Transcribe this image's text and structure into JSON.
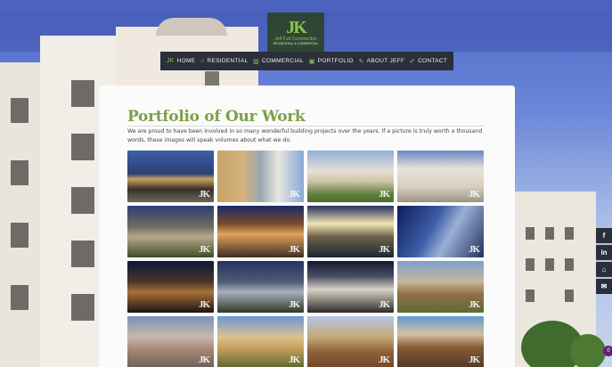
{
  "logo": {
    "mark": "JK",
    "name": "Jeff Futt Construction",
    "tagline": "RESIDENTIAL & COMMERCIAL"
  },
  "nav": {
    "items": [
      {
        "label": "HOME",
        "icon": "jk-icon",
        "glyph": "JK"
      },
      {
        "label": "RESIDENTIAL",
        "icon": "home-icon",
        "glyph": "⌂"
      },
      {
        "label": "COMMERCIAL",
        "icon": "building-icon",
        "glyph": "▥"
      },
      {
        "label": "PORTFOLIO",
        "icon": "image-icon",
        "glyph": "▣"
      },
      {
        "label": "ABOUT JEFF",
        "icon": "pen-icon",
        "glyph": "✎"
      },
      {
        "label": "CONTACT",
        "icon": "pencil-icon",
        "glyph": "✐"
      }
    ]
  },
  "main": {
    "title": "Portfolio of Our Work",
    "intro": "We are proud to have been involved in so many wonderful building projects over the years. If a picture is truly worth a thousand words, these images will speak volumes about what we do."
  },
  "gallery": {
    "watermark": "JK",
    "count": 16
  },
  "social": {
    "items": [
      {
        "name": "facebook-icon",
        "glyph": "f"
      },
      {
        "name": "linkedin-icon",
        "glyph": "in"
      },
      {
        "name": "home-icon",
        "glyph": "⌂"
      },
      {
        "name": "mail-icon",
        "glyph": "✉"
      }
    ],
    "badge": "0"
  },
  "colors": {
    "accent": "#7ca144",
    "nav_bg": "#2b2f3a",
    "logo_bg": "#2f4637",
    "sky": "#5b73c9"
  }
}
